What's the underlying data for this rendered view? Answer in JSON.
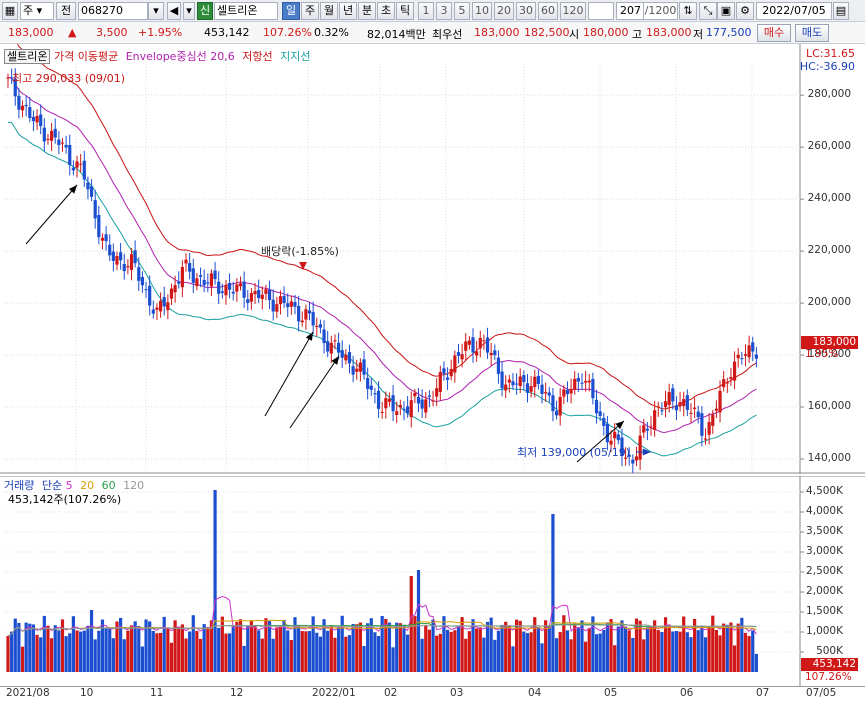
{
  "toolbar": {
    "market_label": "주",
    "prev_label": "전",
    "code": "068270",
    "sin_label": "신",
    "name": "셀트리온",
    "period_tabs": [
      "일",
      "주",
      "월",
      "년",
      "분",
      "초",
      "틱"
    ],
    "intervals": [
      "1",
      "3",
      "5",
      "10",
      "20",
      "30",
      "60",
      "120"
    ],
    "count": "207",
    "count_total": "/1200",
    "date": "2022/07/05"
  },
  "quote": {
    "price": "183,000",
    "change": "3,500",
    "change_pct": "+1.95%",
    "volume": "453,142",
    "volume_ratio": "107.26%",
    "turnover": "0.32%",
    "amount": "82,014백만",
    "best_label": "최우선",
    "best_sell": "183,000",
    "best_buy": "182,500",
    "open_label": "시",
    "open": "180,000",
    "high_label": "고",
    "high": "183,000",
    "low_label": "저",
    "low": "177,500",
    "buy_button": "매수",
    "sell_button": "매도"
  },
  "price_legend": {
    "name": "셀트리온",
    "ma": "가격 이동평균",
    "envelope": "Envelope중심선 20,6",
    "resistance": "저항선",
    "support": "지지선",
    "lc": "LC:31.65",
    "hc": "HC:-36.90"
  },
  "annotations": {
    "high": "최고 290,033 (09/01)",
    "dividend": "배당락(-1.85%)",
    "low": "최저 139,000 (05/19)"
  },
  "price_axis": {
    "ticks": [
      "280,000",
      "260,000",
      "240,000",
      "220,000",
      "200,000",
      "180,000",
      "160,000",
      "140,000"
    ],
    "current": "183,000",
    "current_pct": "1.95%"
  },
  "volume_legend": {
    "title": "거래량",
    "ma": "단순",
    "p5": "5",
    "p20": "20",
    "p60": "60",
    "p120": "120",
    "current": "453,142주(107.26%)"
  },
  "volume_axis": {
    "ticks": [
      "4,500K",
      "4,000K",
      "3,500K",
      "3,000K",
      "2,500K",
      "2,000K",
      "1,500K",
      "1,000K",
      "500K"
    ],
    "current": "453,142",
    "current_pct": "107.26%"
  },
  "x_axis": [
    "2021/08",
    "10",
    "11",
    "12",
    "2022/01",
    "02",
    "03",
    "04",
    "05",
    "06",
    "07",
    "07/05"
  ],
  "colors": {
    "up": "#d01818",
    "down": "#1b4fd0",
    "ma5": "#cc33cc",
    "ma20": "#d4a000",
    "ma60": "#2aa04a",
    "ma120": "#999999",
    "resistance": "#c81414",
    "center": "#b020b0",
    "support": "#1aa0a0"
  },
  "chart_data": [
    {
      "type": "candlestick",
      "title": "셀트리온",
      "x_range": [
        "2021/08",
        "2022/07/05"
      ],
      "ylim": [
        135000,
        292000
      ],
      "series": [
        {
          "name": "셀트리온"
        },
        {
          "name": "가격 이동평균"
        },
        {
          "name": "Envelope중심선 20,6"
        },
        {
          "name": "저항선"
        },
        {
          "name": "지지선"
        }
      ],
      "close_points": [
        [
          "2021/08",
          285000
        ],
        [
          "08/20",
          270000
        ],
        [
          "09/01",
          262000
        ],
        [
          "09/15",
          250000
        ],
        [
          "10",
          218000
        ],
        [
          "10/15",
          215000
        ],
        [
          "11",
          195000
        ],
        [
          "11/10",
          213000
        ],
        [
          "11/20",
          208000
        ],
        [
          "12",
          205000
        ],
        [
          "12/20",
          203000
        ],
        [
          "2022/01",
          200000
        ],
        [
          "01/10",
          195000
        ],
        [
          "01/20",
          183000
        ],
        [
          "01/27",
          175000
        ],
        [
          "02",
          160000
        ],
        [
          "02/15",
          160000
        ],
        [
          "03",
          164000
        ],
        [
          "03/10",
          180000
        ],
        [
          "03/20",
          186000
        ],
        [
          "04",
          168000
        ],
        [
          "04/15",
          170000
        ],
        [
          "04/25",
          160000
        ],
        [
          "05",
          173000
        ],
        [
          "05/10",
          150000
        ],
        [
          "05/19",
          139000
        ],
        [
          "06",
          160000
        ],
        [
          "06/10",
          163000
        ],
        [
          "06/20",
          150000
        ],
        [
          "07",
          176000
        ],
        [
          "07/05",
          183000
        ]
      ]
    },
    {
      "type": "bar",
      "title": "거래량",
      "ylim": [
        0,
        4800
      ],
      "ylabel": "K",
      "series": [
        {
          "name": "거래량"
        },
        {
          "name": "5"
        },
        {
          "name": "20"
        },
        {
          "name": "60"
        },
        {
          "name": "120"
        }
      ],
      "notable_values_k": [
        [
          "11/15",
          4550
        ],
        [
          "03/25",
          3950
        ],
        [
          "01/15",
          2400
        ],
        [
          "01/20",
          2550
        ],
        [
          "2021/09",
          1550
        ],
        [
          "07/05",
          453
        ]
      ]
    }
  ]
}
